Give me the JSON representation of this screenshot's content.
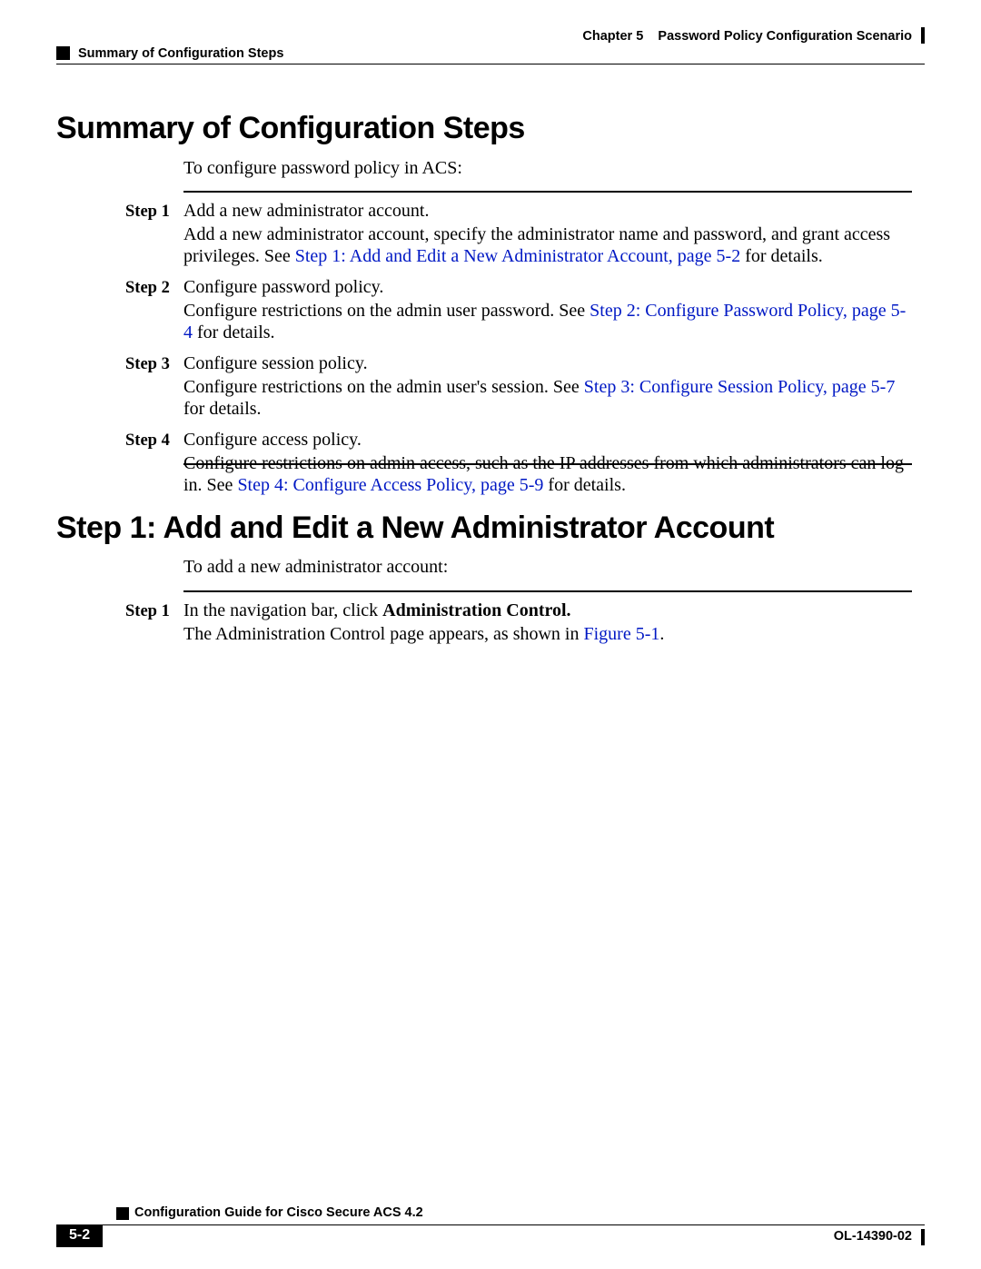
{
  "header": {
    "chapter_label": "Chapter 5",
    "chapter_title": "Password Policy Configuration Scenario",
    "section_title": "Summary of Configuration Steps"
  },
  "section1": {
    "heading": "Summary of Configuration Steps",
    "intro": "To configure password policy in ACS:",
    "steps": {
      "s1": {
        "label": "Step 1",
        "line1": "Add a new administrator account.",
        "para_a": "Add a new administrator account, specify the administrator name and password, and grant access privileges. See ",
        "link": "Step 1: Add and Edit a New Administrator Account, page 5-2",
        "para_b": " for details."
      },
      "s2": {
        "label": "Step 2",
        "line1": "Configure password policy.",
        "para_a": "Configure restrictions on the admin user password. See ",
        "link": "Step 2: Configure Password Policy, page 5-4",
        "para_b": " for details."
      },
      "s3": {
        "label": "Step 3",
        "line1": "Configure session policy.",
        "para_a": "Configure restrictions on the admin user's session. See ",
        "link": "Step 3: Configure Session Policy, page 5-7",
        "para_b": " for details."
      },
      "s4": {
        "label": "Step 4",
        "line1": "Configure access policy.",
        "para_a": "Configure restrictions on admin access, such as the IP addresses from which administrators can log in. See ",
        "link": "Step 4: Configure Access Policy, page 5-9",
        "para_b": " for details."
      }
    }
  },
  "section2": {
    "heading": "Step 1: Add and Edit a New Administrator Account",
    "intro": "To add a new administrator account:",
    "steps": {
      "s1": {
        "label": "Step 1",
        "line1_a": "In the navigation bar, click ",
        "line1_b": "Administration Control.",
        "para_a": "The Administration Control page appears, as shown in ",
        "link": "Figure 5-1",
        "para_b": "."
      }
    }
  },
  "footer": {
    "book_title": "Configuration Guide for Cisco Secure ACS 4.2",
    "page_number": "5-2",
    "doc_number": "OL-14390-02"
  }
}
